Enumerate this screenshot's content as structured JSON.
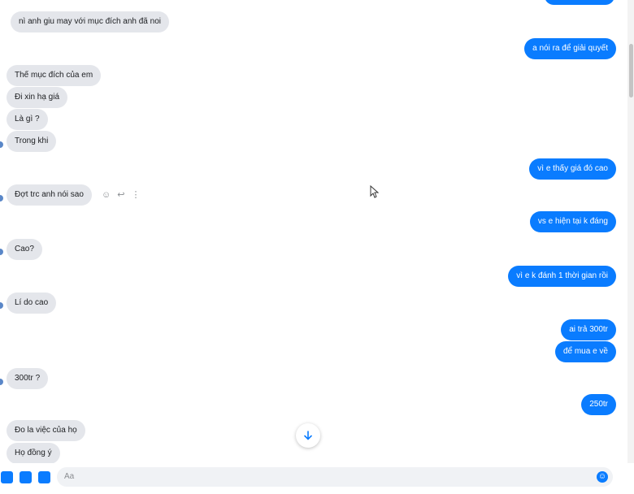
{
  "messages": [
    {
      "side": "in",
      "text": "nì anh giu may với mục đích anh đã noi"
    },
    {
      "side": "out",
      "text": "a nói ra để giải quyết"
    },
    {
      "side": "in",
      "text": "Thế mục đích của em"
    },
    {
      "side": "in",
      "text": "Đi xin hạ giá"
    },
    {
      "side": "in",
      "text": "Là gì ?"
    },
    {
      "side": "in",
      "text": "Trong khi"
    },
    {
      "side": "out",
      "text": "vì e thấy giá đó cao"
    },
    {
      "side": "in",
      "text": "Đợt trc anh nói sao"
    },
    {
      "side": "out",
      "text": "vs e hiện tại k đáng"
    },
    {
      "side": "in",
      "text": "Cao?"
    },
    {
      "side": "out",
      "text": "vì e k đánh 1 thời gian rồi"
    },
    {
      "side": "in",
      "text": "Lí do cao"
    },
    {
      "side": "out",
      "text": "ai trả 300tr"
    },
    {
      "side": "out",
      "text": "để mua e về"
    },
    {
      "side": "in",
      "text": "300tr ?"
    },
    {
      "side": "out",
      "text": "250tr"
    },
    {
      "side": "in",
      "text": "Đo la việc của họ"
    },
    {
      "side": "in",
      "text": "Họ đồng ý"
    }
  ],
  "composer": {
    "placeholder": "Aa"
  },
  "icons": {
    "scroll_down": "arrow-down-icon",
    "emoji": "emoji-icon",
    "react": "smiley-icon",
    "reply": "reply-icon",
    "more": "more-vertical-icon"
  },
  "colors": {
    "outgoing": "#0a7cff",
    "incoming": "#e4e6eb",
    "accent": "#0a7cff"
  }
}
